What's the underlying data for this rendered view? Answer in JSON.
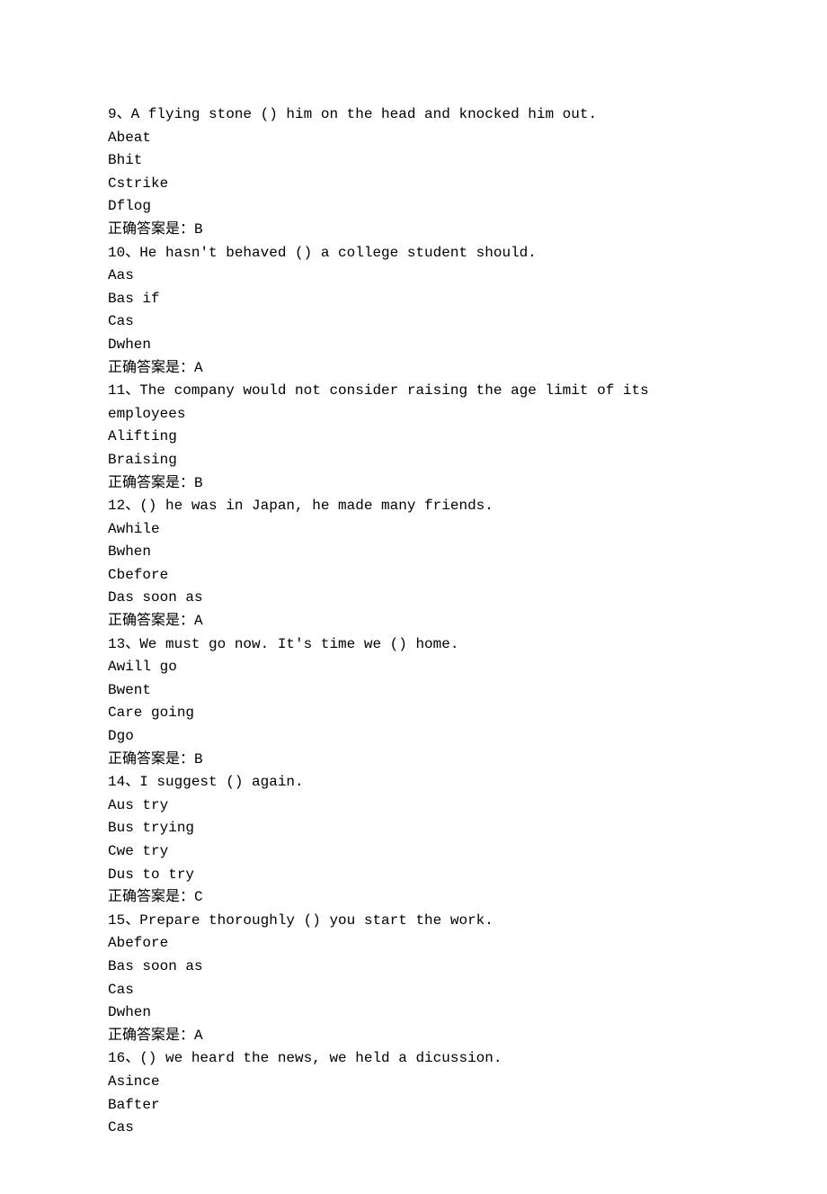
{
  "questions": [
    {
      "num": "9",
      "stem": "A flying stone () him on the head and knocked him out.",
      "options": [
        "Abeat",
        "Bhit",
        "Cstrike",
        "Dflog"
      ],
      "answer": "正确答案是：B"
    },
    {
      "num": "10",
      "stem": "He hasn't behaved () a college student should.",
      "options": [
        "Aas",
        "Bas if",
        "Cas",
        "Dwhen"
      ],
      "answer": "正确答案是：A"
    },
    {
      "num": "11",
      "stem": "The company would not consider raising the age limit of its employees",
      "options": [
        "Alifting",
        "Braising"
      ],
      "answer": "正确答案是：B"
    },
    {
      "num": "12",
      "stem": "() he was in Japan, he made many friends.",
      "options": [
        "Awhile",
        "Bwhen",
        "Cbefore",
        "Das soon as"
      ],
      "answer": "正确答案是：A"
    },
    {
      "num": "13",
      "stem": "We must go now. It's time we () home.",
      "options": [
        "Awill go",
        "Bwent",
        "Care going",
        "Dgo"
      ],
      "answer": "正确答案是：B"
    },
    {
      "num": "14",
      "stem": "I suggest () again.",
      "options": [
        "Aus try",
        "Bus trying",
        "Cwe try",
        "Dus to try"
      ],
      "answer": "正确答案是：C"
    },
    {
      "num": "15",
      "stem": "Prepare thoroughly () you start the work.",
      "options": [
        "Abefore",
        "Bas soon as",
        "Cas",
        "Dwhen"
      ],
      "answer": "正确答案是：A"
    },
    {
      "num": "16",
      "stem": "() we heard the news, we held a dicussion.",
      "options": [
        "Asince",
        "Bafter",
        "Cas"
      ],
      "answer": ""
    }
  ]
}
